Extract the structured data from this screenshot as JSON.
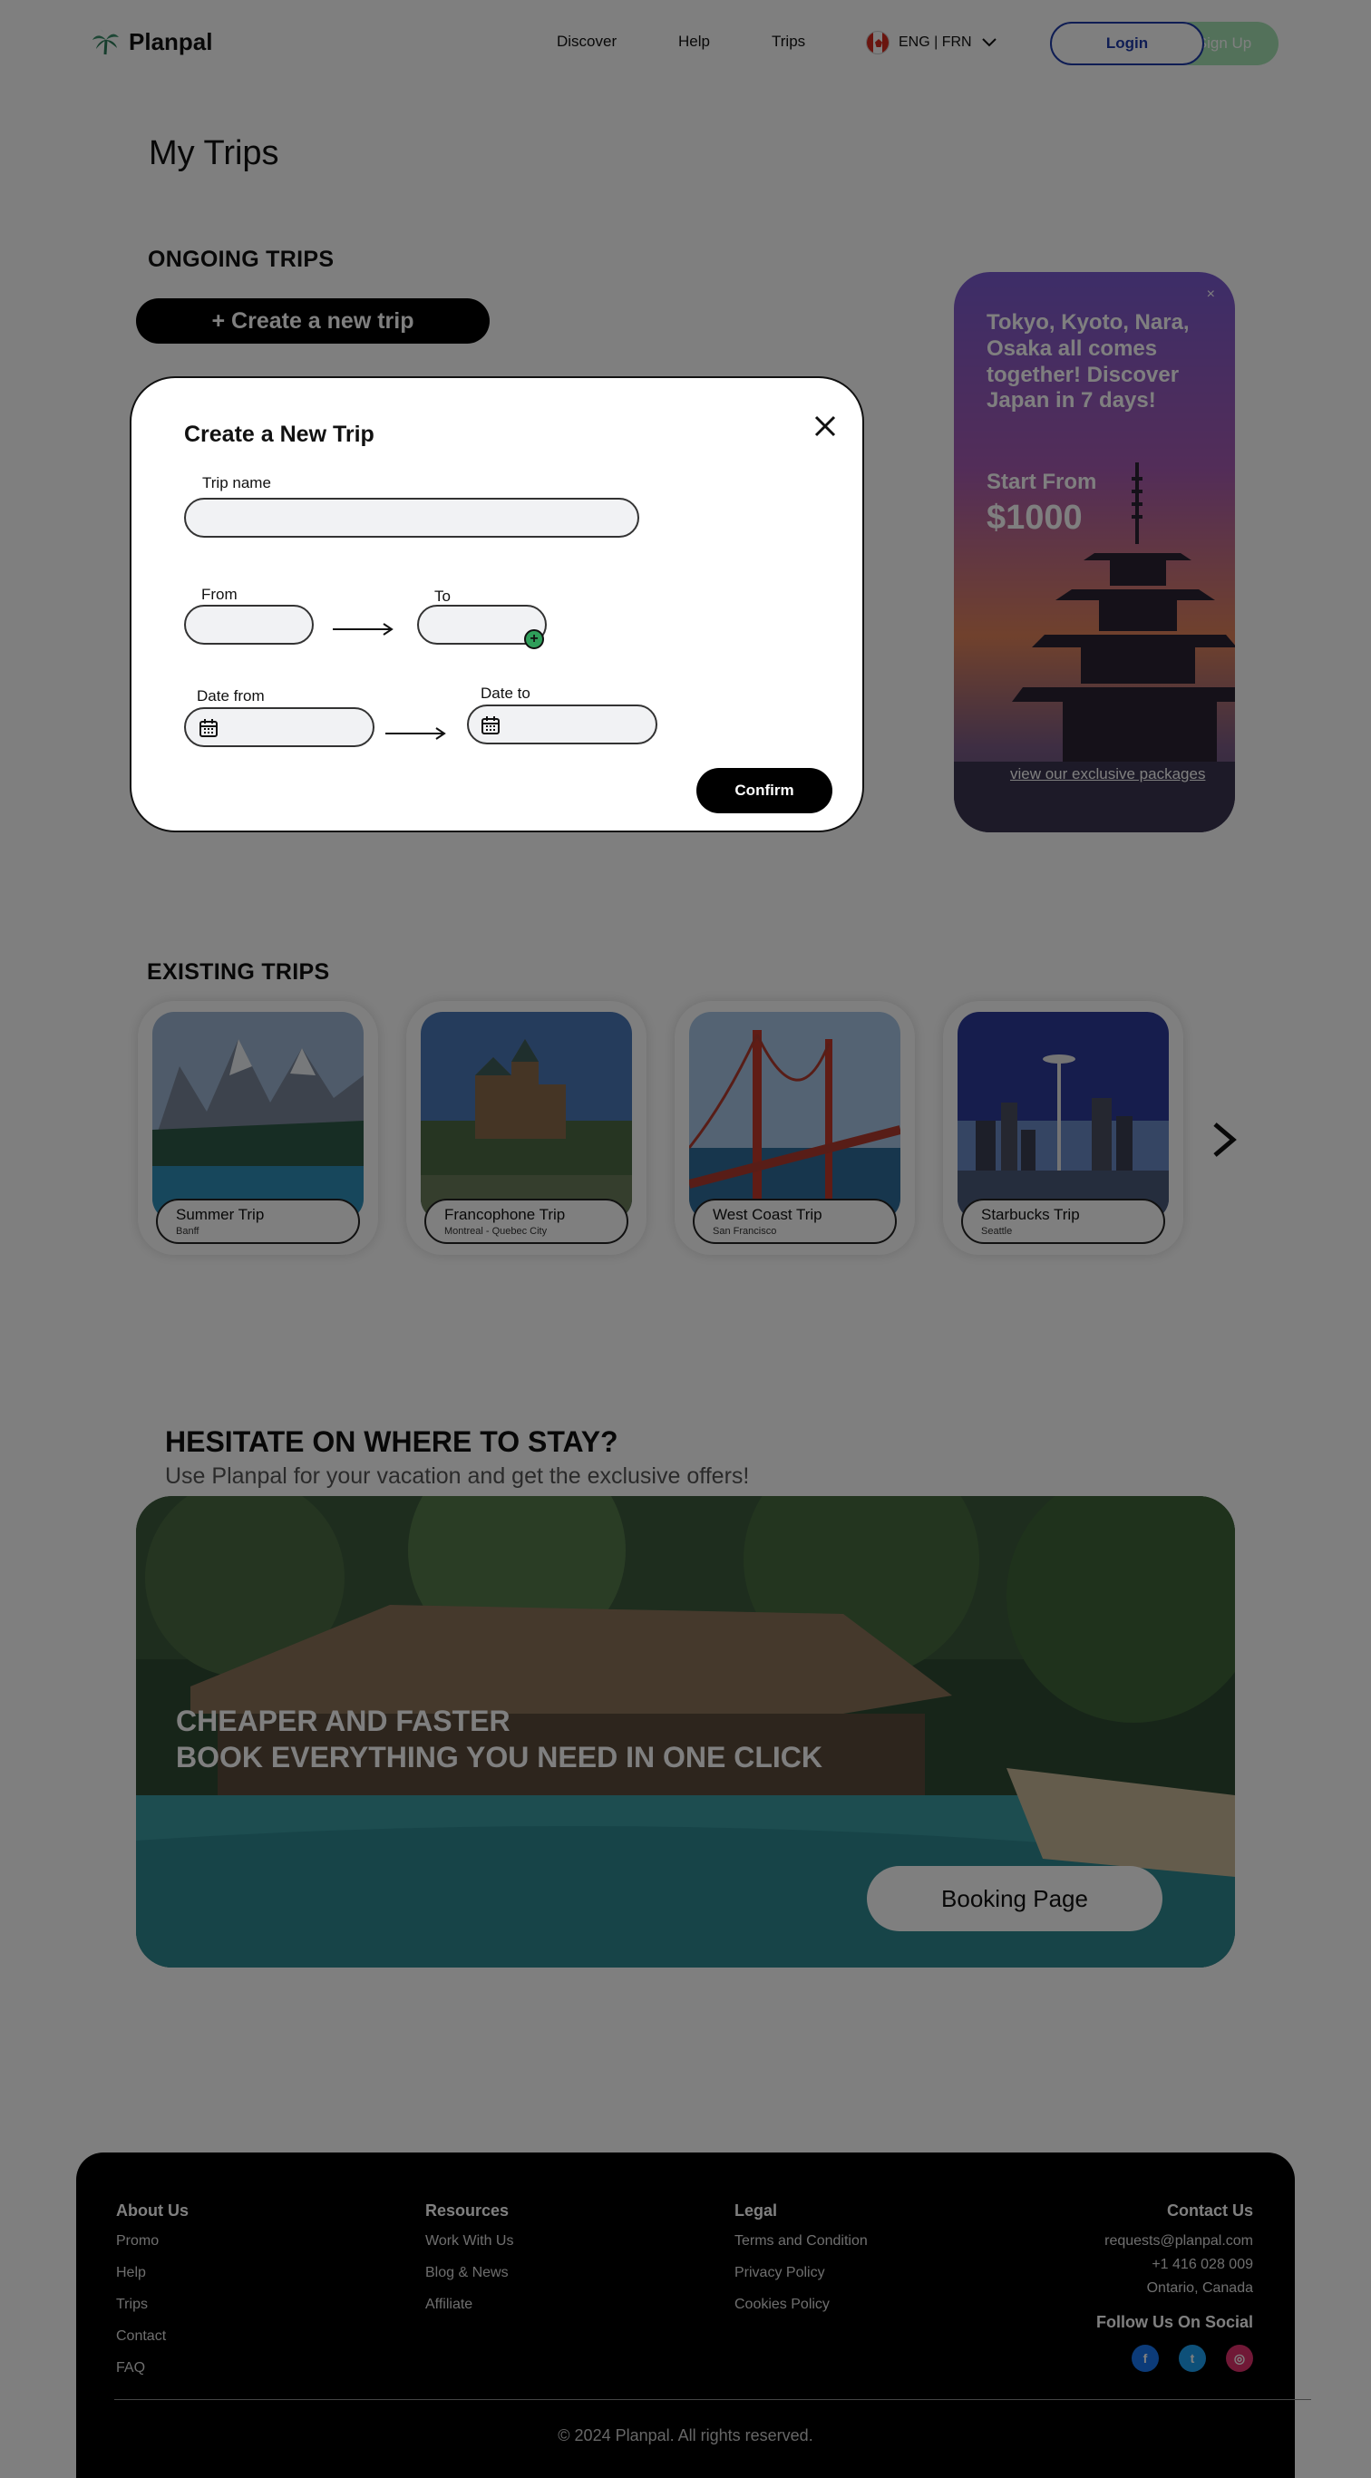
{
  "header": {
    "brand": "Planpal",
    "nav": [
      "Discover",
      "Help",
      "Trips"
    ],
    "language": "ENG | FRN",
    "login_label": "Login",
    "signup_label": "Sign Up"
  },
  "page": {
    "title": "My Trips",
    "ongoing_title": "ONGOING TRIPS",
    "create_label": "+ Create a new trip",
    "existing_title": "EXISTING TRIPS"
  },
  "promo": {
    "close": "×",
    "text": "Tokyo, Kyoto, Nara, Osaka all comes together! Discover Japan in 7 days!",
    "from_label": "Start From",
    "price": "$1000",
    "link_label": "view our exclusive packages"
  },
  "trips": [
    {
      "name": "Summer Trip",
      "location": "Banff"
    },
    {
      "name": "Francophone Trip",
      "location": "Montreal - Quebec City"
    },
    {
      "name": "West Coast Trip",
      "location": "San Francisco"
    },
    {
      "name": "Starbucks Trip",
      "location": "Seattle"
    }
  ],
  "stay": {
    "title": "HESITATE ON WHERE TO STAY?",
    "subtitle": "Use Planpal for your vacation and get the exclusive offers!",
    "line1": "CHEAPER AND FASTER",
    "line2": "BOOK EVERYTHING YOU NEED IN ONE CLICK",
    "booking_label": "Booking Page"
  },
  "modal": {
    "title": "Create a New Trip",
    "trip_name_label": "Trip name",
    "trip_name_value": "",
    "from_label": "From",
    "from_value": "",
    "to_label": "To",
    "to_value": "",
    "add_symbol": "+",
    "date_from_label": "Date from",
    "date_from_value": "",
    "date_to_label": "Date to",
    "date_to_value": "",
    "confirm_label": "Confirm"
  },
  "footer": {
    "about": {
      "title": "About Us",
      "items": [
        "Promo",
        "Help",
        "Trips",
        "Contact",
        "FAQ"
      ]
    },
    "resources": {
      "title": "Resources",
      "items": [
        "Work With Us",
        "Blog & News",
        "Affiliate"
      ]
    },
    "legal": {
      "title": "Legal",
      "items": [
        "Terms and Condition",
        "Privacy Policy",
        "Cookies Policy"
      ]
    },
    "contact": {
      "title": "Contact Us",
      "email": "requests@planpal.com",
      "phone": "+1 416 028 009",
      "location": "Ontario, Canada"
    },
    "social_title": "Follow Us On Social",
    "social_icons": [
      "facebook-icon",
      "twitter-icon",
      "instagram-icon"
    ],
    "copyright": "© 2024 Planpal. All rights reserved."
  },
  "colors": {
    "brand_green": "#a6e3b4",
    "login_blue": "#1f3aa8",
    "facebook": "#1877f2",
    "twitter": "#1da1f2",
    "instagram": "#e1306c"
  }
}
